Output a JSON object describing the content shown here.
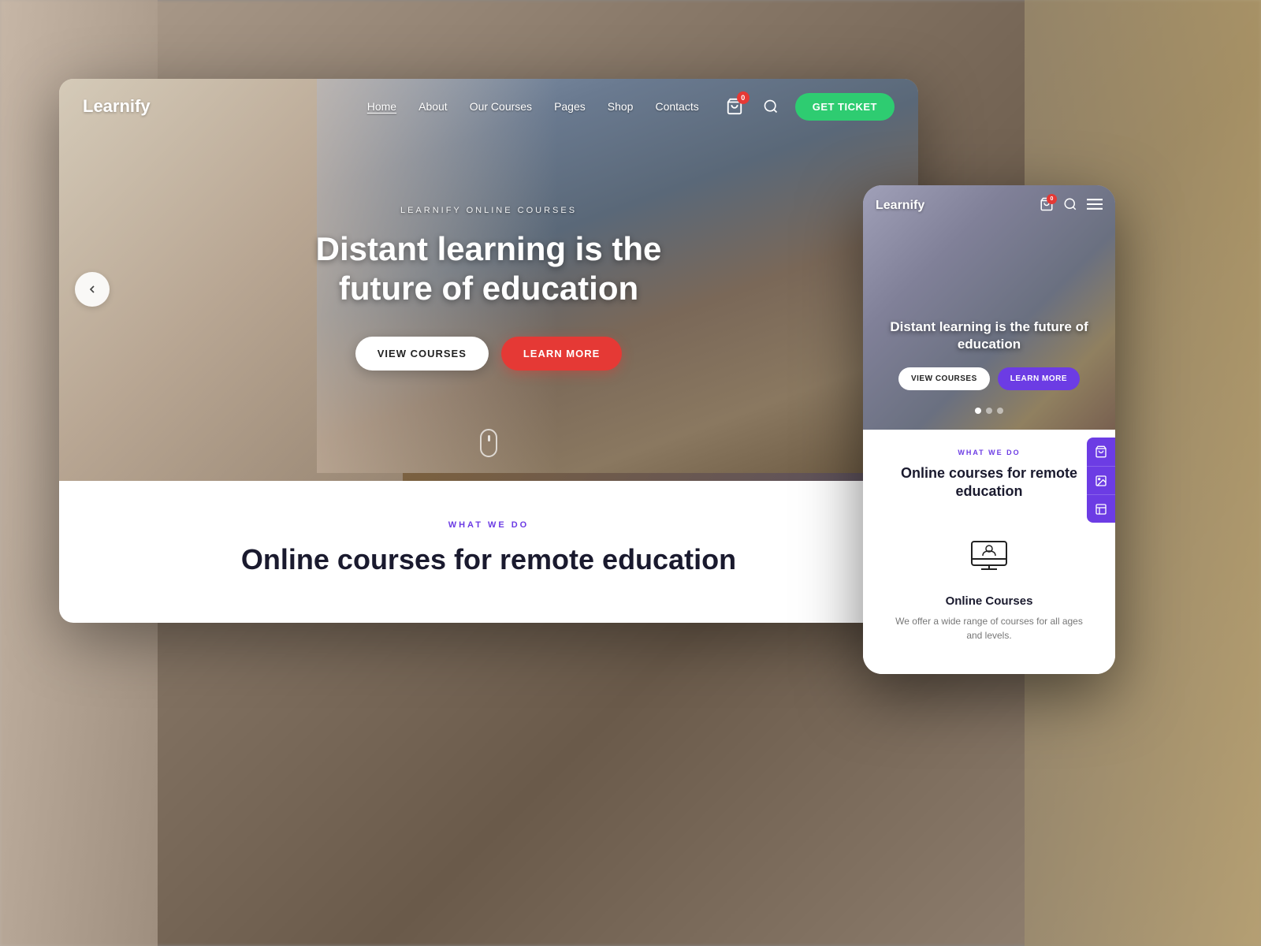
{
  "background": {
    "description": "Blurred background with person"
  },
  "desktop": {
    "logo": "Learnify",
    "nav": {
      "links": [
        {
          "label": "Home",
          "active": true
        },
        {
          "label": "About",
          "active": false
        },
        {
          "label": "Our Courses",
          "active": false
        },
        {
          "label": "Pages",
          "active": false
        },
        {
          "label": "Shop",
          "active": false
        },
        {
          "label": "Contacts",
          "active": false
        }
      ],
      "cart_count": "0",
      "get_ticket_label": "GET TICKET"
    },
    "hero": {
      "subtitle": "LEARNIFY ONLINE COURSES",
      "title": "Distant learning is the future of education",
      "btn_view": "VIEW COURSES",
      "btn_learn": "LEARN MORE"
    },
    "content": {
      "what_we_do": "WHAT WE DO",
      "section_title": "Online courses for remote education"
    }
  },
  "mobile": {
    "logo": "Learnify",
    "cart_count": "0",
    "hero": {
      "title": "Distant learning is the future of education",
      "btn_view": "VIEW COURSES",
      "btn_learn": "LEARN MORE"
    },
    "content": {
      "what_we_do": "WHAT WE DO",
      "section_title": "Online courses for remote education",
      "course_card": {
        "title": "Online Courses",
        "description": "We offer a wide range of courses for all ages and levels."
      }
    }
  }
}
